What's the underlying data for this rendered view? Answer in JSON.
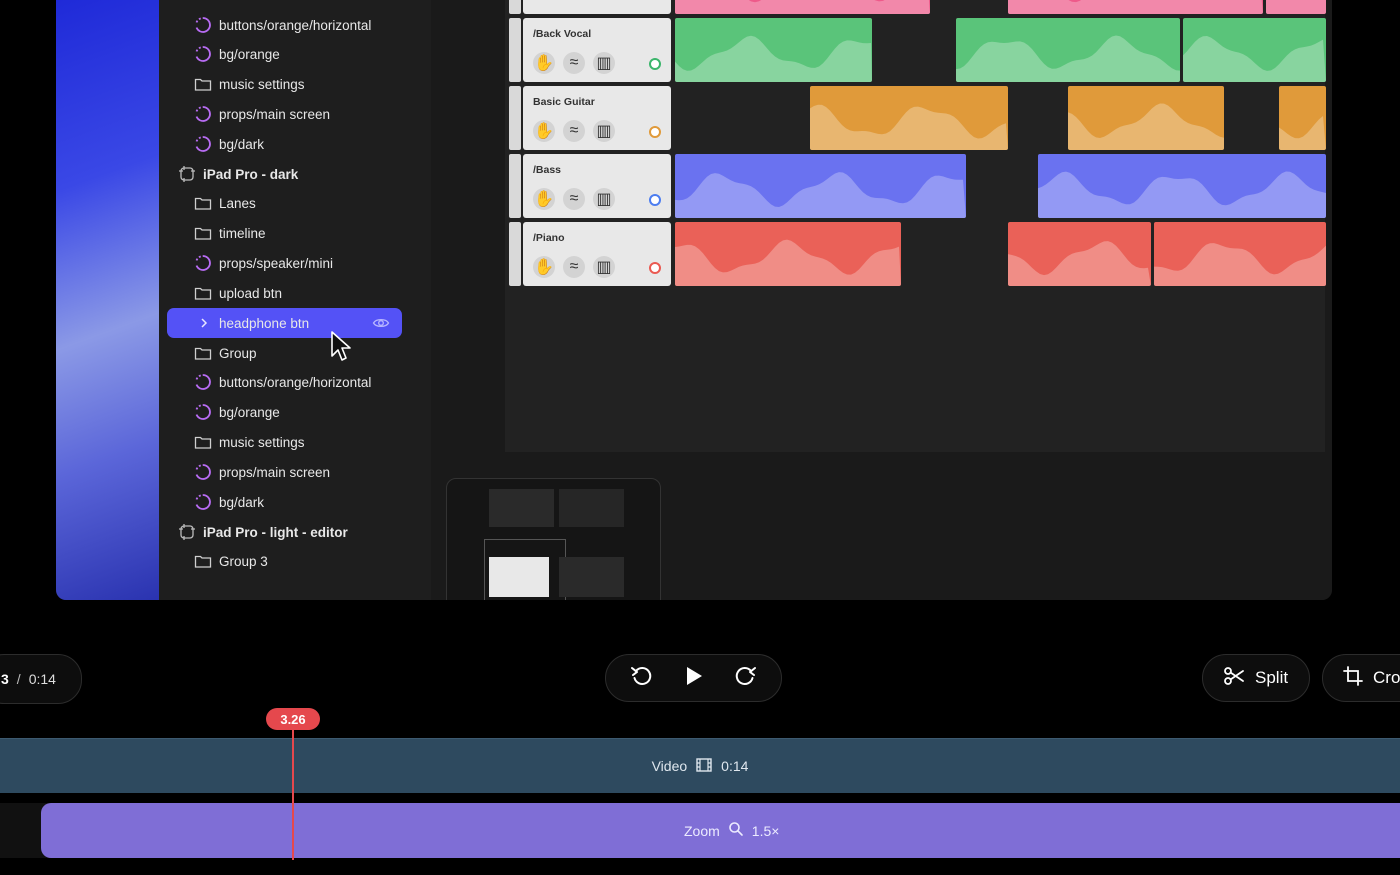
{
  "layers": {
    "items": [
      {
        "name": "buttons/orange/horizontal",
        "kind": "component"
      },
      {
        "name": "bg/orange",
        "kind": "component"
      },
      {
        "name": "music settings",
        "kind": "folder"
      },
      {
        "name": "props/main screen",
        "kind": "component"
      },
      {
        "name": "bg/dark",
        "kind": "component"
      },
      {
        "name": "iPad Pro - dark",
        "kind": "frame"
      },
      {
        "name": "Lanes",
        "kind": "folder"
      },
      {
        "name": "timeline",
        "kind": "folder"
      },
      {
        "name": "props/speaker/mini",
        "kind": "component"
      },
      {
        "name": "upload btn",
        "kind": "folder"
      },
      {
        "name": "headphone btn",
        "kind": "selected"
      },
      {
        "name": "Group",
        "kind": "folder"
      },
      {
        "name": "buttons/orange/horizontal",
        "kind": "component"
      },
      {
        "name": "bg/orange",
        "kind": "component"
      },
      {
        "name": "music settings",
        "kind": "folder"
      },
      {
        "name": "props/main screen",
        "kind": "component"
      },
      {
        "name": "bg/dark",
        "kind": "component"
      },
      {
        "name": "iPad Pro - light - editor",
        "kind": "frame"
      },
      {
        "name": "Group 3",
        "kind": "folder"
      }
    ]
  },
  "tracks": [
    {
      "name": "/Back Vocal",
      "color": "#5ac47a",
      "dot": "#3bb56b"
    },
    {
      "name": "Basic Guitar",
      "color": "#e09a3a",
      "dot": "#e09a3a"
    },
    {
      "name": "/Bass",
      "color": "#6a72f0",
      "dot": "#4c7df0"
    },
    {
      "name": "/Piano",
      "color": "#ea6158",
      "dot": "#ea5a52"
    }
  ],
  "top_clip_color": "#ee5a8a",
  "player": {
    "current_time": "3",
    "separator": "/",
    "total_time": "0:14",
    "split_label": "Split",
    "crop_label": "Cro"
  },
  "timeline": {
    "playhead_label": "3.26",
    "video_label": "Video",
    "video_duration": "0:14",
    "zoom_label": "Zoom",
    "zoom_value": "1.5×"
  },
  "icons": {
    "component": "component-icon",
    "folder": "folder-icon",
    "frame": "frame-icon",
    "eye": "eye-icon",
    "rewind": "rewind-icon",
    "play": "play-icon",
    "forward": "forward-icon",
    "scissors": "scissors-icon",
    "crop": "crop-icon",
    "film": "film-icon",
    "magnifier": "magnifier-icon"
  }
}
